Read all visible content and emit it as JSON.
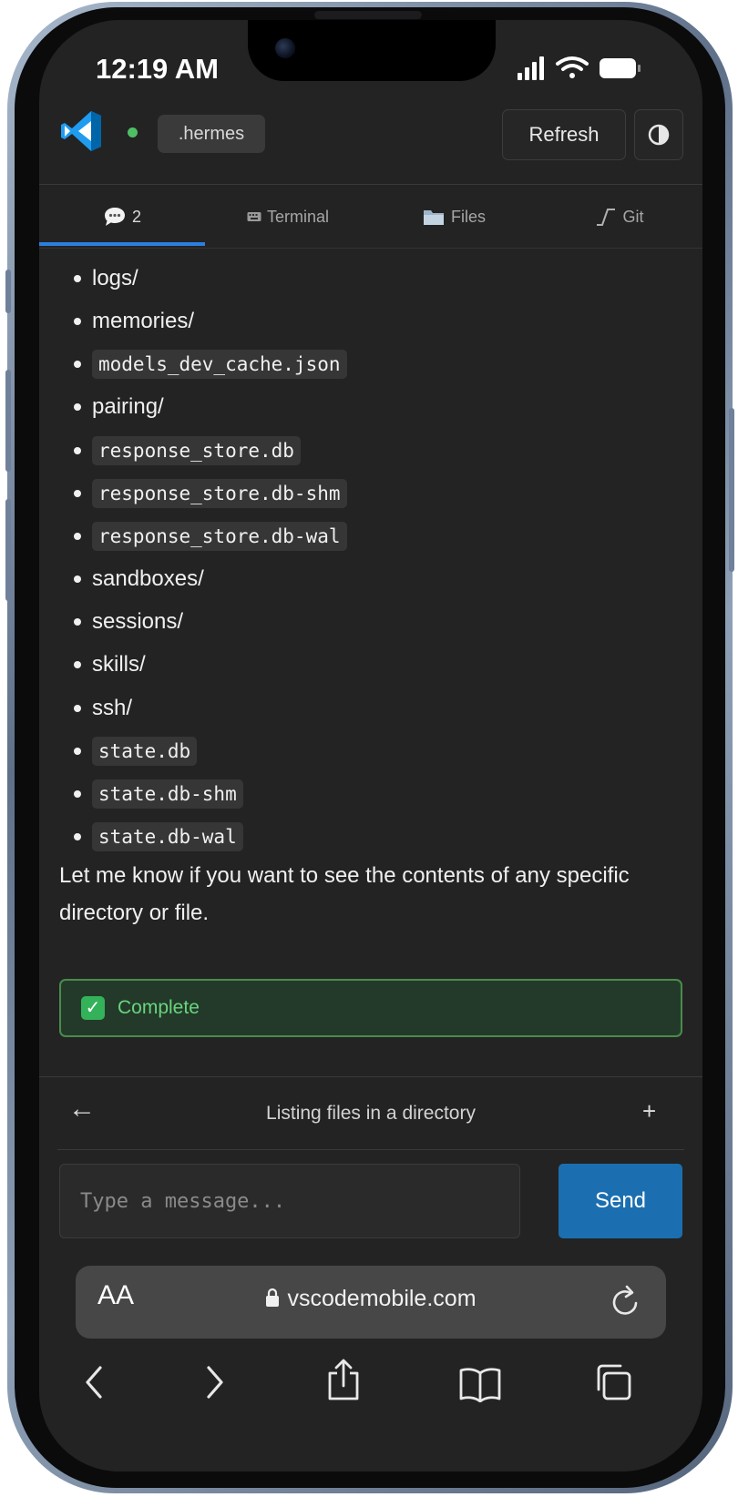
{
  "status_bar": {
    "time": "12:19 AM"
  },
  "header": {
    "workspace": ".hermes",
    "refresh_label": "Refresh"
  },
  "tabs": [
    {
      "label": "2",
      "icon": "chat-bubble-icon",
      "active": true
    },
    {
      "label": "Terminal",
      "icon": "keyboard-icon",
      "active": false
    },
    {
      "label": "Files",
      "icon": "folder-icon",
      "active": false
    },
    {
      "label": "Git",
      "icon": "git-icon",
      "active": false
    }
  ],
  "chat": {
    "files": [
      {
        "name": "logs/",
        "code": false
      },
      {
        "name": "memories/",
        "code": false
      },
      {
        "name": "models_dev_cache.json",
        "code": true
      },
      {
        "name": "pairing/",
        "code": false
      },
      {
        "name": "response_store.db",
        "code": true
      },
      {
        "name": "response_store.db-shm",
        "code": true
      },
      {
        "name": "response_store.db-wal",
        "code": true
      },
      {
        "name": "sandboxes/",
        "code": false
      },
      {
        "name": "sessions/",
        "code": false
      },
      {
        "name": "skills/",
        "code": false
      },
      {
        "name": "ssh/",
        "code": false
      },
      {
        "name": "state.db",
        "code": true
      },
      {
        "name": "state.db-shm",
        "code": true
      },
      {
        "name": "state.db-wal",
        "code": true
      }
    ],
    "closing": "Let me know if you want to see the contents of any specific directory or file.",
    "status_label": "Complete"
  },
  "conversation": {
    "back": "←",
    "title": "Listing files in a directory",
    "new": "+"
  },
  "composer": {
    "placeholder": "Type a message...",
    "send_label": "Send"
  },
  "browser": {
    "text_size": "AA",
    "url": "vscodemobile.com"
  },
  "colors": {
    "accent": "#1b6fb0",
    "tab_underline": "#2b7fe0",
    "success": "#6ad47d",
    "background": "#232323"
  }
}
